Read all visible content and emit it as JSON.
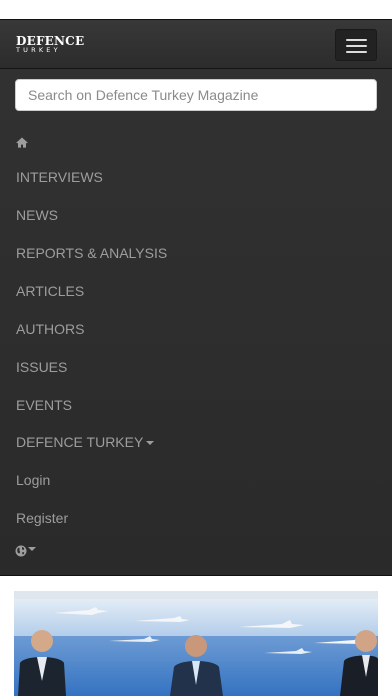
{
  "brand": {
    "line1": "DEFENCE",
    "line2": "TURKEY"
  },
  "search": {
    "placeholder": "Search on Defence Turkey Magazine"
  },
  "menu": {
    "interviews": "INTERVIEWS",
    "news": "NEWS",
    "reports": "REPORTS & ANALYSIS",
    "articles": "ARTICLES",
    "authors": "AUTHORS",
    "issues": "ISSUES",
    "events": "EVENTS",
    "defence_turkey": "DEFENCE TURKEY",
    "login": "Login",
    "register": "Register"
  },
  "icons": {
    "toggle": "hamburger-menu-icon",
    "home": "home-icon",
    "language": "globe-icon",
    "dropdown": "caret-down-icon"
  },
  "colors": {
    "navbar_bg": "#2e2e2e",
    "menu_text": "#9d9d9d",
    "brand_text": "#ffffff"
  }
}
